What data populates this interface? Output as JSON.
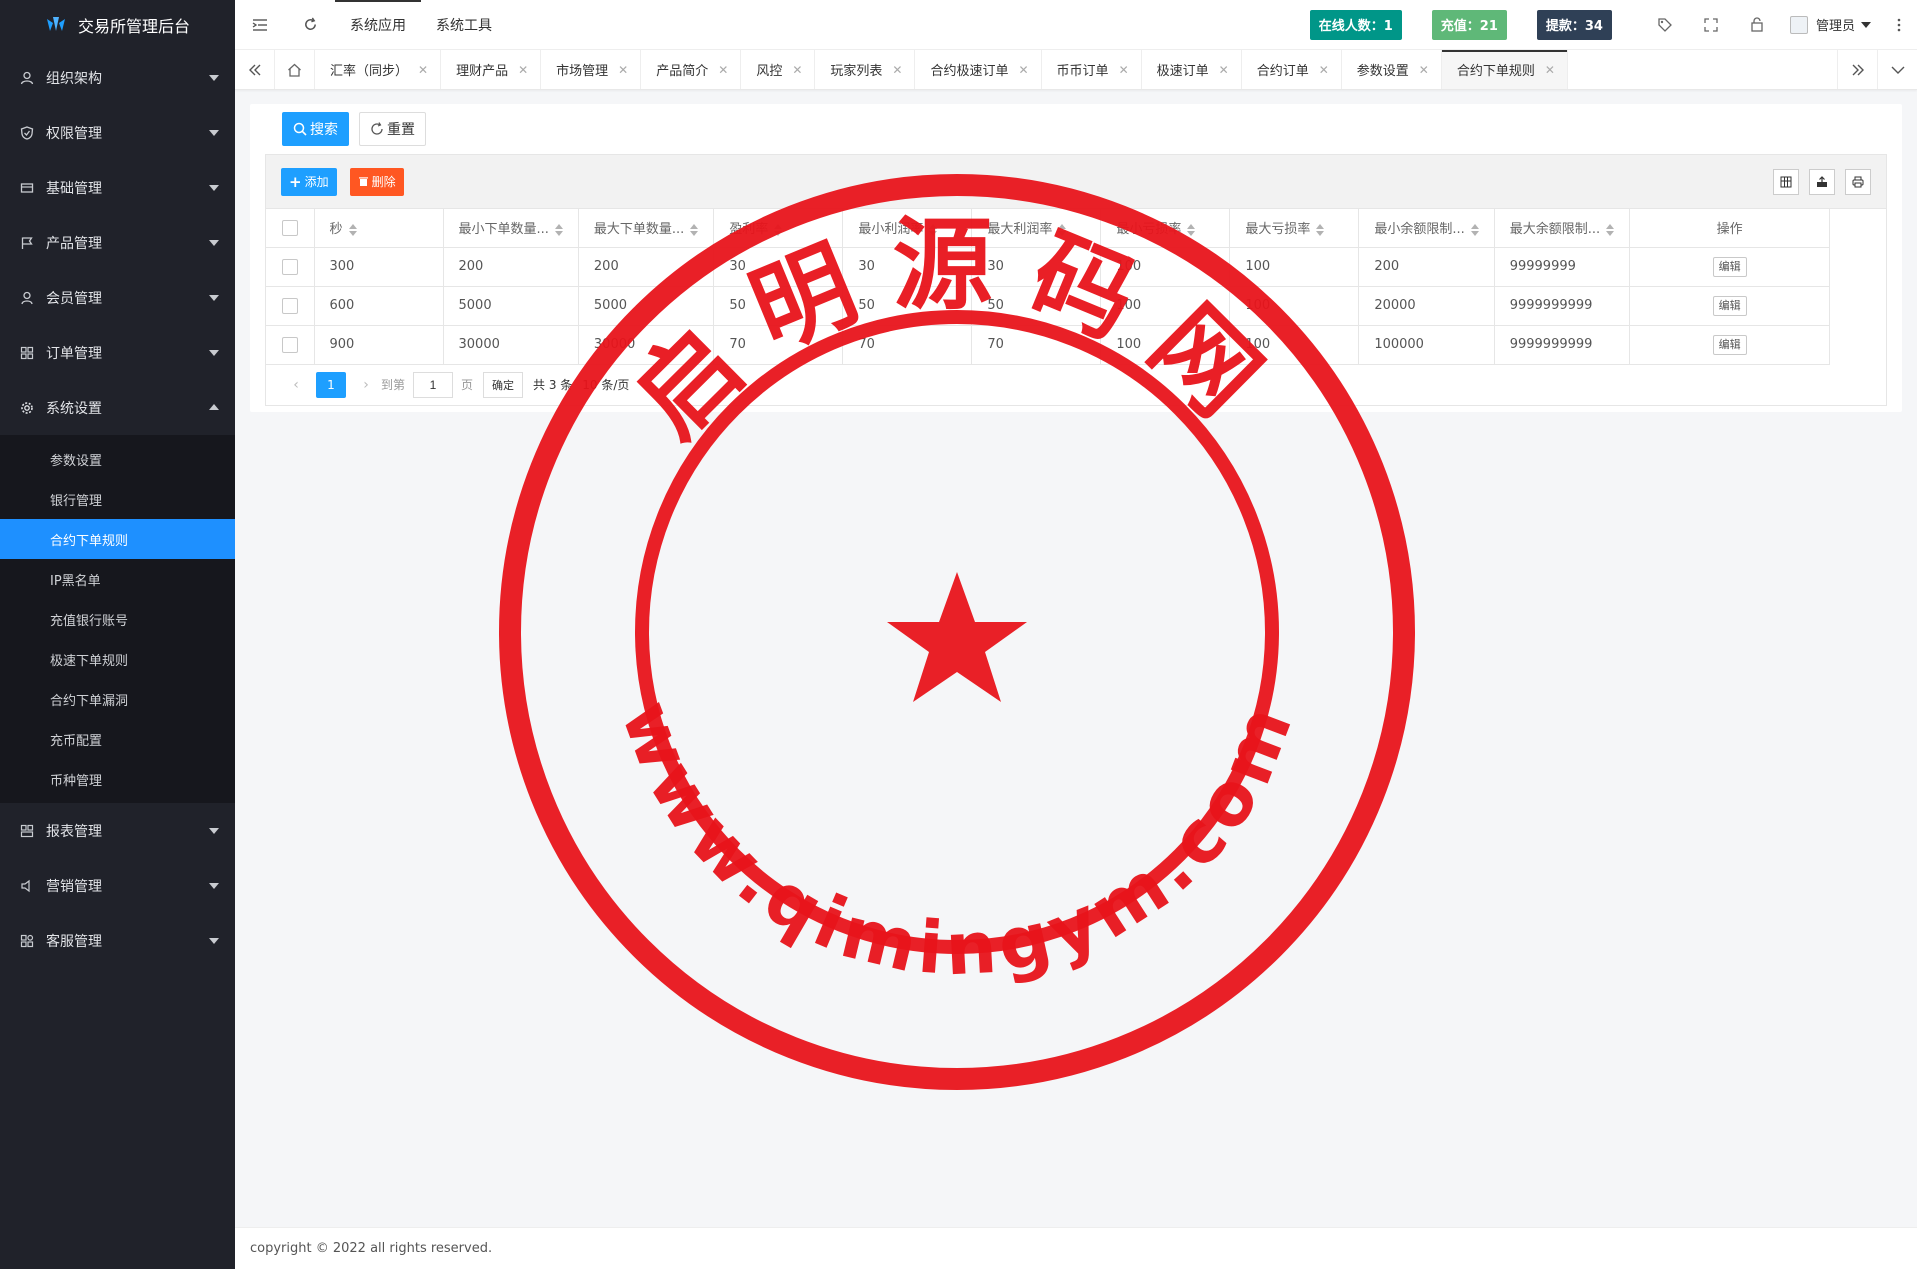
{
  "app": {
    "title": "交易所管理后台"
  },
  "sidebar": {
    "items": [
      {
        "label": "组织架构",
        "icon": "users-icon"
      },
      {
        "label": "权限管理",
        "icon": "shield-icon"
      },
      {
        "label": "基础管理",
        "icon": "database-icon"
      },
      {
        "label": "产品管理",
        "icon": "flag-icon"
      },
      {
        "label": "会员管理",
        "icon": "user-icon"
      },
      {
        "label": "订单管理",
        "icon": "grid-icon"
      },
      {
        "label": "系统设置",
        "icon": "gear-icon"
      },
      {
        "label": "报表管理",
        "icon": "chart-icon"
      },
      {
        "label": "营销管理",
        "icon": "speaker-icon"
      },
      {
        "label": "客服管理",
        "icon": "apps-icon"
      }
    ],
    "system_submenu": [
      "参数设置",
      "银行管理",
      "合约下单规则",
      "IP黑名单",
      "充值银行账号",
      "极速下单规则",
      "合约下单漏洞",
      "充币配置",
      "币种管理"
    ],
    "active_sub": "合约下单规则"
  },
  "header": {
    "nav": [
      "系统应用",
      "系统工具"
    ],
    "online": "在线人数：1",
    "charge": "充值：21",
    "withdraw": "提款：34",
    "user": "管理员"
  },
  "tabs": [
    {
      "label": "汇率（同步）"
    },
    {
      "label": "理财产品"
    },
    {
      "label": "市场管理"
    },
    {
      "label": "产品简介"
    },
    {
      "label": "风控"
    },
    {
      "label": "玩家列表"
    },
    {
      "label": "合约极速订单"
    },
    {
      "label": "币币订单"
    },
    {
      "label": "极速订单"
    },
    {
      "label": "合约订单"
    },
    {
      "label": "参数设置"
    },
    {
      "label": "合约下单规则",
      "active": true
    }
  ],
  "search": {
    "search_label": "搜索",
    "reset_label": "重置"
  },
  "toolbar": {
    "add_label": "添加",
    "delete_label": "删除"
  },
  "table": {
    "columns": [
      "秒",
      "最小下单数量...",
      "最大下单数量...",
      "盈利率",
      "最小利润率",
      "最大利润率",
      "最小亏损率",
      "最大亏损率",
      "最小余额限制...",
      "最大余额限制...",
      "操作"
    ],
    "rows": [
      [
        "300",
        "200",
        "200",
        "30",
        "30",
        "30",
        "100",
        "100",
        "200",
        "99999999"
      ],
      [
        "600",
        "5000",
        "5000",
        "50",
        "50",
        "50",
        "100",
        "100",
        "20000",
        "9999999999"
      ],
      [
        "900",
        "30000",
        "30000",
        "70",
        "70",
        "70",
        "100",
        "100",
        "100000",
        "9999999999"
      ]
    ],
    "edit_label": "编辑"
  },
  "pager": {
    "current": "1",
    "goto_label": "到第",
    "page_value": "1",
    "page_unit": "页",
    "confirm_label": "确定",
    "total": "共 3 条",
    "page_size": "10 条/页"
  },
  "footer": {
    "copyright": "copyright © 2022 all rights reserved."
  },
  "watermark": {
    "top_text": "启明源码网",
    "bottom_text": "www.qimingym.com"
  },
  "colors": {
    "sidebar_bg": "#20222a",
    "accent": "#1e9fff",
    "danger": "#ff5722",
    "online": "#009688",
    "charge": "#5fb878",
    "withdraw": "#2f4056",
    "stamp_red": "#e8141b"
  }
}
